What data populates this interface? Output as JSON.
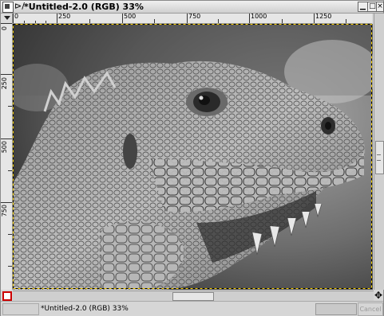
{
  "window": {
    "title": "*Untitled-2.0 (RGB) 33%",
    "menu_glyph": "⊳/",
    "buttons": {
      "minimize": "▁",
      "maximize": "□",
      "close": "×"
    }
  },
  "ruler_top": {
    "labels": [
      "0",
      "250",
      "500",
      "750",
      "1000",
      "1250"
    ]
  },
  "ruler_left": {
    "labels": [
      "0",
      "250",
      "500",
      "750"
    ]
  },
  "canvas": {
    "description_icon": "iguana-photo-grayscale",
    "selection_marquee": true
  },
  "statusbar": {
    "text": "*Untitled-2.0 (RGB) 33%",
    "cancel_label": "Cancel"
  },
  "icons": {
    "quickmask": "quickmask-toggle-icon",
    "navigate": "navigate-icon",
    "ruler_menu": "menu-arrow-icon"
  },
  "colors": {
    "quickmask_border": "#cc0000"
  }
}
